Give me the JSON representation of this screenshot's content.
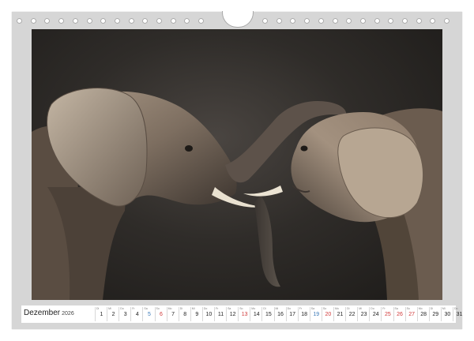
{
  "calendar": {
    "month": "Dezember",
    "year": "2026",
    "days": [
      {
        "weekday": "Di",
        "day": "1",
        "kind": "normal"
      },
      {
        "weekday": "Mi",
        "day": "2",
        "kind": "normal"
      },
      {
        "weekday": "Do",
        "day": "3",
        "kind": "normal"
      },
      {
        "weekday": "Fr",
        "day": "4",
        "kind": "normal"
      },
      {
        "weekday": "Sa",
        "day": "5",
        "kind": "holiday"
      },
      {
        "weekday": "So",
        "day": "6",
        "kind": "sunday"
      },
      {
        "weekday": "Mo",
        "day": "7",
        "kind": "normal"
      },
      {
        "weekday": "Di",
        "day": "8",
        "kind": "normal"
      },
      {
        "weekday": "Mi",
        "day": "9",
        "kind": "normal"
      },
      {
        "weekday": "Do",
        "day": "10",
        "kind": "normal"
      },
      {
        "weekday": "Fr",
        "day": "11",
        "kind": "normal"
      },
      {
        "weekday": "Sa",
        "day": "12",
        "kind": "normal"
      },
      {
        "weekday": "So",
        "day": "13",
        "kind": "sunday"
      },
      {
        "weekday": "Mo",
        "day": "14",
        "kind": "normal"
      },
      {
        "weekday": "Di",
        "day": "15",
        "kind": "normal"
      },
      {
        "weekday": "Mi",
        "day": "16",
        "kind": "normal"
      },
      {
        "weekday": "Do",
        "day": "17",
        "kind": "normal"
      },
      {
        "weekday": "Fr",
        "day": "18",
        "kind": "normal"
      },
      {
        "weekday": "Sa",
        "day": "19",
        "kind": "holiday"
      },
      {
        "weekday": "So",
        "day": "20",
        "kind": "sunday"
      },
      {
        "weekday": "Mo",
        "day": "21",
        "kind": "normal"
      },
      {
        "weekday": "Di",
        "day": "22",
        "kind": "normal"
      },
      {
        "weekday": "Mi",
        "day": "23",
        "kind": "normal"
      },
      {
        "weekday": "Do",
        "day": "24",
        "kind": "normal"
      },
      {
        "weekday": "Fr",
        "day": "25",
        "kind": "sunday"
      },
      {
        "weekday": "Sa",
        "day": "26",
        "kind": "sunday"
      },
      {
        "weekday": "So",
        "day": "27",
        "kind": "sunday"
      },
      {
        "weekday": "Mo",
        "day": "28",
        "kind": "normal"
      },
      {
        "weekday": "Di",
        "day": "29",
        "kind": "normal"
      },
      {
        "weekday": "Mi",
        "day": "30",
        "kind": "normal"
      },
      {
        "weekday": "Do",
        "day": "31",
        "kind": "normal"
      }
    ]
  },
  "photo": {
    "icon": "elephants-photo"
  },
  "colors": {
    "frame": "#d6d6d6",
    "sunday": "#d03a3a",
    "holiday": "#3b7ab8",
    "text": "#222222"
  }
}
